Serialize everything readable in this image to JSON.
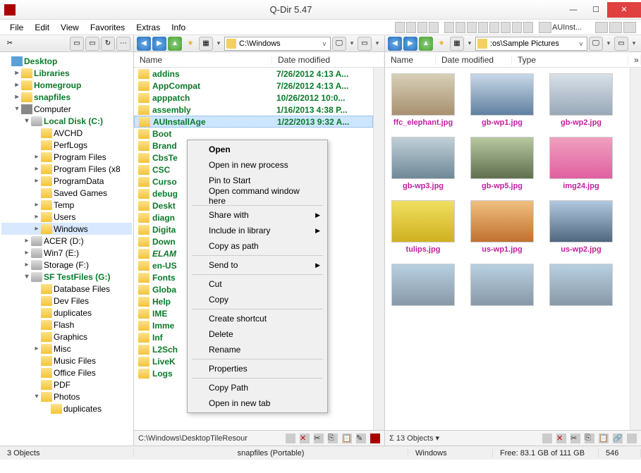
{
  "title": "Q-Dir 5.47",
  "menu": {
    "file": "File",
    "edit": "Edit",
    "view": "View",
    "favorites": "Favorites",
    "extras": "Extras",
    "info": "Info",
    "addr_title": "AUInst..."
  },
  "tree": {
    "nodes": [
      {
        "ind": 0,
        "label": "Desktop",
        "cls": "green",
        "icon": "desktop",
        "exp": ""
      },
      {
        "ind": 1,
        "label": "Libraries",
        "cls": "green",
        "icon": "folder",
        "exp": "▸"
      },
      {
        "ind": 1,
        "label": "Homegroup",
        "cls": "green",
        "icon": "folder",
        "exp": "▸"
      },
      {
        "ind": 1,
        "label": "snapfiles",
        "cls": "green",
        "icon": "folder",
        "exp": "▸"
      },
      {
        "ind": 1,
        "label": "Computer",
        "cls": "",
        "icon": "comp",
        "exp": "▾"
      },
      {
        "ind": 2,
        "label": "Local Disk (C:)",
        "cls": "green",
        "icon": "disk",
        "exp": "▾"
      },
      {
        "ind": 3,
        "label": "AVCHD",
        "cls": "",
        "icon": "folder",
        "exp": ""
      },
      {
        "ind": 3,
        "label": "PerfLogs",
        "cls": "",
        "icon": "folder",
        "exp": ""
      },
      {
        "ind": 3,
        "label": "Program Files",
        "cls": "",
        "icon": "folder",
        "exp": "▸"
      },
      {
        "ind": 3,
        "label": "Program Files (x8",
        "cls": "",
        "icon": "folder",
        "exp": "▸"
      },
      {
        "ind": 3,
        "label": "ProgramData",
        "cls": "",
        "icon": "folder",
        "exp": "▸"
      },
      {
        "ind": 3,
        "label": "Saved Games",
        "cls": "",
        "icon": "folder",
        "exp": ""
      },
      {
        "ind": 3,
        "label": "Temp",
        "cls": "",
        "icon": "folder",
        "exp": "▸"
      },
      {
        "ind": 3,
        "label": "Users",
        "cls": "",
        "icon": "folder",
        "exp": "▸"
      },
      {
        "ind": 3,
        "label": "Windows",
        "cls": "sel",
        "icon": "folder",
        "exp": "▸"
      },
      {
        "ind": 2,
        "label": "ACER (D:)",
        "cls": "",
        "icon": "disk",
        "exp": "▸"
      },
      {
        "ind": 2,
        "label": "Win7 (E:)",
        "cls": "",
        "icon": "disk",
        "exp": "▸"
      },
      {
        "ind": 2,
        "label": "Storage (F:)",
        "cls": "",
        "icon": "disk",
        "exp": "▸"
      },
      {
        "ind": 2,
        "label": "SF TestFiles (G:)",
        "cls": "green",
        "icon": "disk",
        "exp": "▾"
      },
      {
        "ind": 3,
        "label": "Database Files",
        "cls": "",
        "icon": "folder",
        "exp": ""
      },
      {
        "ind": 3,
        "label": "Dev Files",
        "cls": "",
        "icon": "folder",
        "exp": ""
      },
      {
        "ind": 3,
        "label": "duplicates",
        "cls": "",
        "icon": "folder",
        "exp": ""
      },
      {
        "ind": 3,
        "label": "Flash",
        "cls": "",
        "icon": "folder",
        "exp": ""
      },
      {
        "ind": 3,
        "label": "Graphics",
        "cls": "",
        "icon": "folder",
        "exp": ""
      },
      {
        "ind": 3,
        "label": "Misc",
        "cls": "",
        "icon": "folder",
        "exp": "▸"
      },
      {
        "ind": 3,
        "label": "Music Files",
        "cls": "",
        "icon": "folder",
        "exp": ""
      },
      {
        "ind": 3,
        "label": "Office Files",
        "cls": "",
        "icon": "folder",
        "exp": ""
      },
      {
        "ind": 3,
        "label": "PDF",
        "cls": "",
        "icon": "folder",
        "exp": ""
      },
      {
        "ind": 3,
        "label": "Photos",
        "cls": "",
        "icon": "folder",
        "exp": "▾"
      },
      {
        "ind": 4,
        "label": "duplicates",
        "cls": "",
        "icon": "folder",
        "exp": ""
      }
    ]
  },
  "panel_mid": {
    "path": "C:\\Windows",
    "cols": {
      "name": "Name",
      "date": "Date modified"
    },
    "rows": [
      {
        "name": "addins",
        "date": "7/26/2012 4:13 A..."
      },
      {
        "name": "AppCompat",
        "date": "7/26/2012 4:13 A..."
      },
      {
        "name": "apppatch",
        "date": "10/26/2012 10:0..."
      },
      {
        "name": "assembly",
        "date": "1/16/2013 4:38 P..."
      },
      {
        "name": "AUInstallAge",
        "date": "1/22/2013 9:32 A...",
        "sel": true
      },
      {
        "name": "Boot",
        "date": ""
      },
      {
        "name": "Brand",
        "date": ""
      },
      {
        "name": "CbsTe",
        "date": ""
      },
      {
        "name": "CSC",
        "date": ""
      },
      {
        "name": "Curso",
        "date": ""
      },
      {
        "name": "debug",
        "date": ""
      },
      {
        "name": "Deskt",
        "date": ""
      },
      {
        "name": "diagn",
        "date": ""
      },
      {
        "name": "Digita",
        "date": ""
      },
      {
        "name": "Down",
        "date": ""
      },
      {
        "name": "ELAM",
        "date": "",
        "italic": true
      },
      {
        "name": "en-US",
        "date": ""
      },
      {
        "name": "Fonts",
        "date": ""
      },
      {
        "name": "Globa",
        "date": ""
      },
      {
        "name": "Help",
        "date": ""
      },
      {
        "name": "IME",
        "date": ""
      },
      {
        "name": "Imme",
        "date": ""
      },
      {
        "name": "Inf",
        "date": ""
      },
      {
        "name": "L2Sch",
        "date": ""
      },
      {
        "name": "LiveK",
        "date": ""
      },
      {
        "name": "Logs",
        "date": ""
      }
    ],
    "status_path": "C:\\Windows\\DesktopTileResour"
  },
  "panel_right": {
    "path": ":os\\Sample Pictures",
    "cols": {
      "name": "Name",
      "date": "Date modified",
      "type": "Type"
    },
    "thumbs": [
      {
        "label": "ffc_elephant.jpg",
        "bg": "linear-gradient(#d8d0b8,#a89070)"
      },
      {
        "label": "gb-wp1.jpg",
        "bg": "linear-gradient(#c8d8e8,#6080a0)"
      },
      {
        "label": "gb-wp2.jpg",
        "bg": "linear-gradient(#d8e0e8,#98a8b8)"
      },
      {
        "label": "gb-wp3.jpg",
        "bg": "linear-gradient(#c0d0d8,#708898)"
      },
      {
        "label": "gb-wp5.jpg",
        "bg": "linear-gradient(#b8c8a0,#607050)"
      },
      {
        "label": "img24.jpg",
        "bg": "linear-gradient(#f0a0c0,#e060a0)"
      },
      {
        "label": "tulips.jpg",
        "bg": "linear-gradient(#f0e060,#d0b020)"
      },
      {
        "label": "us-wp1.jpg",
        "bg": "linear-gradient(#f0c080,#c07030)"
      },
      {
        "label": "us-wp2.jpg",
        "bg": "linear-gradient(#b0c8e0,#506880)"
      }
    ],
    "status": "Σ  13 Objects  ▾"
  },
  "context_menu": {
    "items": [
      {
        "label": "Open",
        "bold": true
      },
      {
        "label": "Open in new process"
      },
      {
        "label": "Pin to Start"
      },
      {
        "label": "Open command window here"
      },
      {
        "sep": true
      },
      {
        "label": "Share with",
        "sub": true
      },
      {
        "label": "Include in library",
        "sub": true
      },
      {
        "label": "Copy as path"
      },
      {
        "sep": true
      },
      {
        "label": "Send to",
        "sub": true
      },
      {
        "sep": true
      },
      {
        "label": "Cut"
      },
      {
        "label": "Copy"
      },
      {
        "sep": true
      },
      {
        "label": "Create shortcut"
      },
      {
        "label": "Delete"
      },
      {
        "label": "Rename"
      },
      {
        "sep": true
      },
      {
        "label": "Properties"
      },
      {
        "sep": true
      },
      {
        "label": "Copy Path"
      },
      {
        "label": "Open in new tab"
      }
    ]
  },
  "statusbar": {
    "objects": "3 Objects",
    "mid": "snapfiles (Portable)",
    "loc": "Windows",
    "free": "Free: 83.1 GB of 111 GB",
    "count": "546"
  }
}
